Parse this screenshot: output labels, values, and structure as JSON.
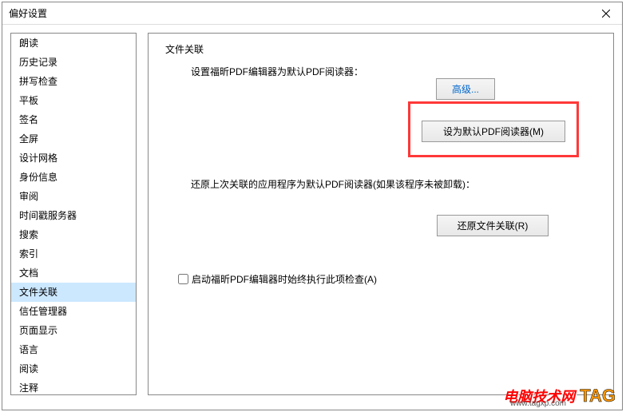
{
  "window": {
    "title": "偏好设置"
  },
  "sidebar": {
    "items": [
      {
        "label": "朗读"
      },
      {
        "label": "历史记录"
      },
      {
        "label": "拼写检查"
      },
      {
        "label": "平板"
      },
      {
        "label": "签名"
      },
      {
        "label": "全屏"
      },
      {
        "label": "设计网格"
      },
      {
        "label": "身份信息"
      },
      {
        "label": "审阅"
      },
      {
        "label": "时间戳服务器"
      },
      {
        "label": "搜索"
      },
      {
        "label": "索引"
      },
      {
        "label": "文档"
      },
      {
        "label": "文件关联"
      },
      {
        "label": "信任管理器"
      },
      {
        "label": "页面显示"
      },
      {
        "label": "语言"
      },
      {
        "label": "阅读"
      },
      {
        "label": "注释"
      }
    ],
    "selected_index": 13
  },
  "panel": {
    "title": "文件关联",
    "desc1": "设置福昕PDF编辑器为默认PDF阅读器：",
    "advanced_label": "高级...",
    "default_label": "设为默认PDF阅读器(M)",
    "desc2": "还原上次关联的应用程序为默认PDF阅读器(如果该程序未被卸载)：",
    "restore_label": "还原文件关联(R)",
    "checkbox_label": "启动福昕PDF编辑器时始终执行此项检查(A)",
    "checkbox_checked": false
  },
  "watermark": {
    "text_cn": "电脑技术网",
    "url": "www.tagxp.com",
    "tag": "TAG"
  }
}
